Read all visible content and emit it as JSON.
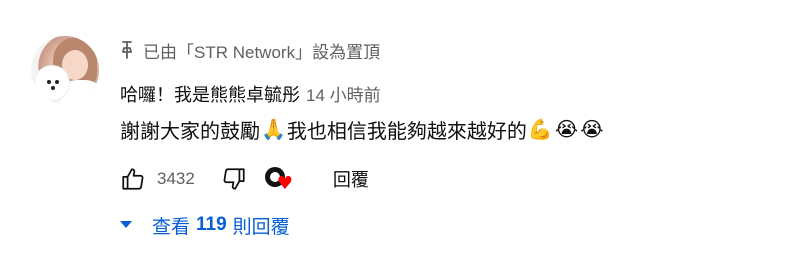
{
  "comment": {
    "pinned_text": "已由「STR Network」設為置頂",
    "author": "哈囉！我是熊熊卓毓彤",
    "timestamp": "14 小時前",
    "text_before_emoji": "謝謝大家的鼓勵",
    "emoji_pray": "🙏",
    "text_after_emoji": "我也相信我能夠越來越好的",
    "emoji_muscle": "💪",
    "emoji_cry_1": "😭",
    "emoji_cry_2": "😭",
    "like_count": "3432",
    "reply_label": "回覆",
    "creator_heart": "♥"
  },
  "replies": {
    "prefix": "查看",
    "count": "119",
    "suffix": "則回覆"
  },
  "colors": {
    "link_blue": "#065fd4",
    "secondary_text": "#606060",
    "heart_red": "#ff0000"
  },
  "icons": {
    "pin": "pin-icon",
    "like": "thumbs-up-icon",
    "dislike": "thumbs-down-icon",
    "caret": "caret-down-icon"
  }
}
